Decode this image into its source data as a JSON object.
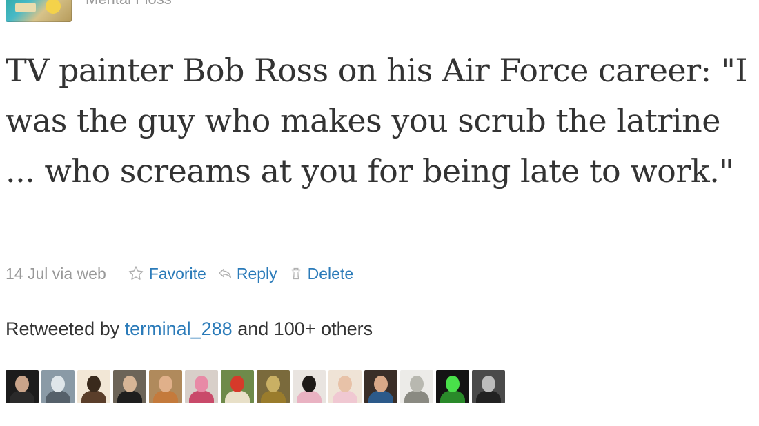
{
  "author": {
    "name": "Mental Floss",
    "avatar_icon": "profile-thumbnail-icon"
  },
  "tweet": {
    "text": "TV painter Bob Ross on his Air Force career: \"I was the guy who makes you scrub the latrine ... who screams at you for being late to work.\""
  },
  "meta": {
    "timestamp": "14 Jul via web",
    "actions": [
      {
        "label": "Favorite",
        "icon": "star-icon"
      },
      {
        "label": "Reply",
        "icon": "reply-arrow-icon"
      },
      {
        "label": "Delete",
        "icon": "trash-icon"
      }
    ]
  },
  "retweet": {
    "prefix": "Retweeted by ",
    "user": "terminal_288",
    "suffix": " and 100+ others"
  },
  "colors": {
    "link": "#2b7bb9",
    "muted": "#999999",
    "text": "#333333"
  },
  "retweeters": [
    {
      "bg": "#1c1c1c",
      "head": "#c9a48a",
      "body": "#2a2a2a"
    },
    {
      "bg": "#8a9aa6",
      "head": "#dfe6ea",
      "body": "#55606a"
    },
    {
      "bg": "#f2e7d6",
      "head": "#3a2a1c",
      "body": "#5a3e2a"
    },
    {
      "bg": "#6c6458",
      "head": "#d7b596",
      "body": "#1e1e1e"
    },
    {
      "bg": "#b08a5c",
      "head": "#e0b08a",
      "body": "#c47a3c"
    },
    {
      "bg": "#d8cfc9",
      "head": "#e88aa6",
      "body": "#c94a6a"
    },
    {
      "bg": "#6e8a4a",
      "head": "#d63a2a",
      "body": "#e8e0c8"
    },
    {
      "bg": "#7a6a3c",
      "head": "#c9b064",
      "body": "#9a7c2c"
    },
    {
      "bg": "#e9e4e0",
      "head": "#1e1a18",
      "body": "#e9b2c2"
    },
    {
      "bg": "#efe3d6",
      "head": "#e8c2a8",
      "body": "#f0c8d2"
    },
    {
      "bg": "#3a2e28",
      "head": "#d9a888",
      "body": "#2c5a8a"
    },
    {
      "bg": "#ecebe8",
      "head": "#b8b8b0",
      "body": "#8a8a82"
    },
    {
      "bg": "#141414",
      "head": "#49e04a",
      "body": "#2a8a2a"
    },
    {
      "bg": "#4a4a4a",
      "head": "#bcbcbc",
      "body": "#222222"
    }
  ]
}
